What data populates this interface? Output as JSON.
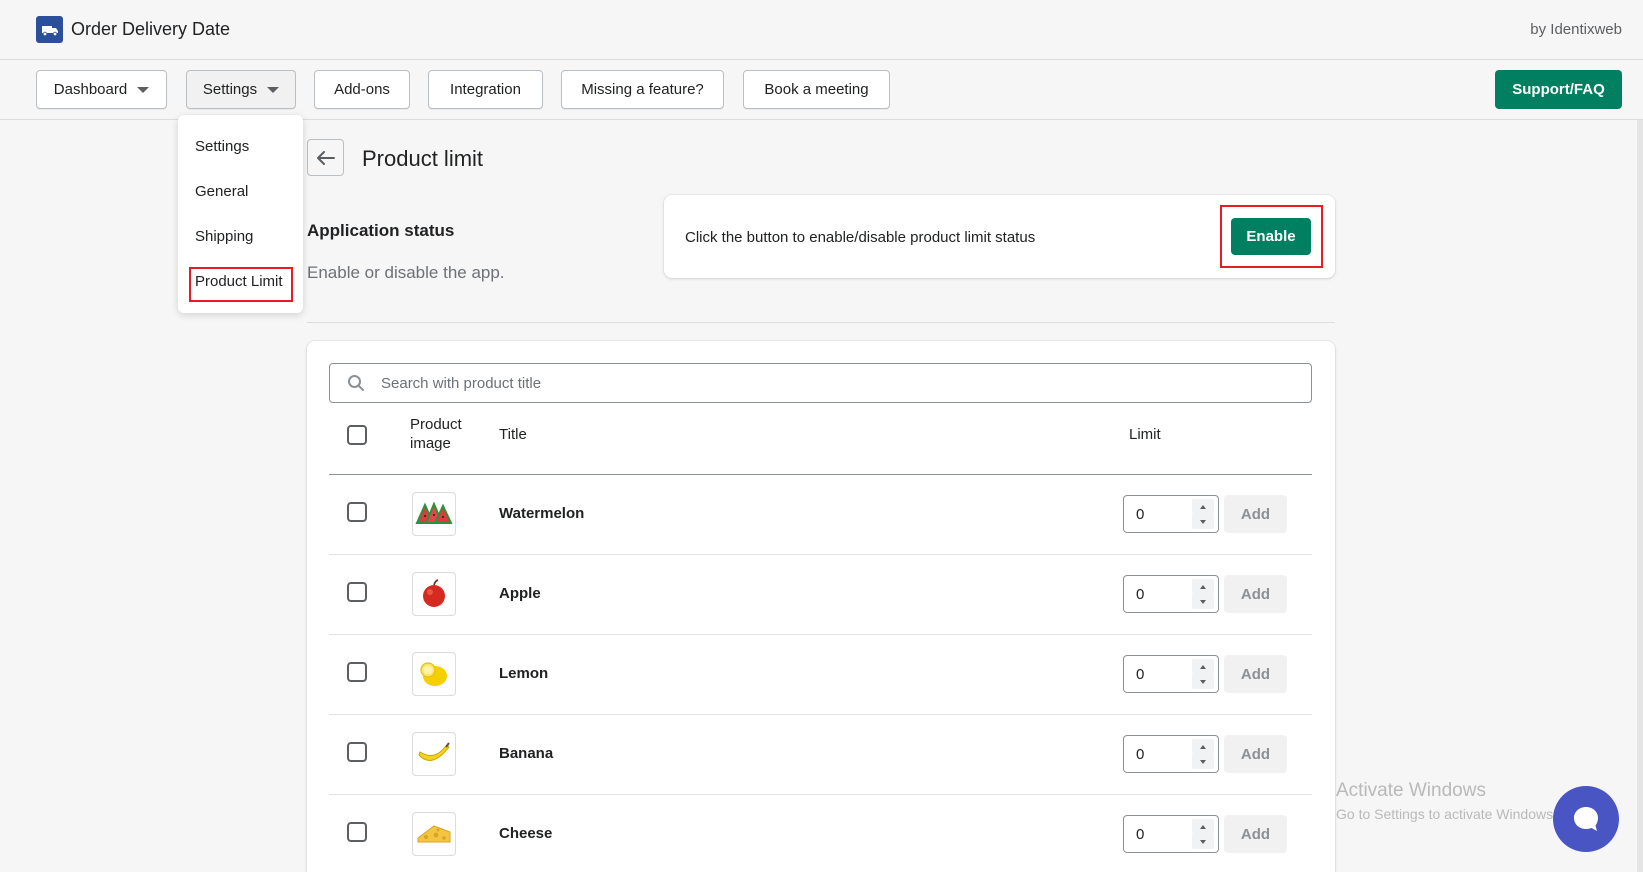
{
  "app": {
    "title": "Order Delivery Date",
    "byline": "by Identixweb",
    "logo_icon": "delivery-truck-icon",
    "brand_color": "#2b4f9a"
  },
  "nav": {
    "dashboard": "Dashboard",
    "settings": "Settings",
    "addons": "Add-ons",
    "integration": "Integration",
    "missing_feature": "Missing a feature?",
    "book_meeting": "Book a meeting",
    "support": "Support/FAQ"
  },
  "settings_menu": {
    "items": [
      "Settings",
      "General",
      "Shipping",
      "Product Limit"
    ],
    "highlighted": "Product Limit"
  },
  "page": {
    "title": "Product limit"
  },
  "status_section": {
    "heading": "Application status",
    "description": "Enable or disable the app.",
    "card_text": "Click the button to enable/disable product limit status",
    "button_label": "Enable",
    "button_color": "#008060"
  },
  "table": {
    "search_placeholder": "Search with product title",
    "headers": {
      "image_line1": "Product",
      "image_line2": "image",
      "title": "Title",
      "limit": "Limit"
    },
    "rows": [
      {
        "title": "Watermelon",
        "limit": "0",
        "add": "Add",
        "icon": "watermelon-icon"
      },
      {
        "title": "Apple",
        "limit": "0",
        "add": "Add",
        "icon": "apple-icon"
      },
      {
        "title": "Lemon",
        "limit": "0",
        "add": "Add",
        "icon": "lemon-icon"
      },
      {
        "title": "Banana",
        "limit": "0",
        "add": "Add",
        "icon": "banana-icon"
      },
      {
        "title": "Cheese",
        "limit": "0",
        "add": "Add",
        "icon": "cheese-icon"
      }
    ]
  },
  "watermark": {
    "line1": "Activate Windows",
    "line2": "Go to Settings to activate Windows."
  },
  "colors": {
    "primary": "#008060",
    "highlight_outline": "#e51c23",
    "chat": "#4a55c4"
  }
}
